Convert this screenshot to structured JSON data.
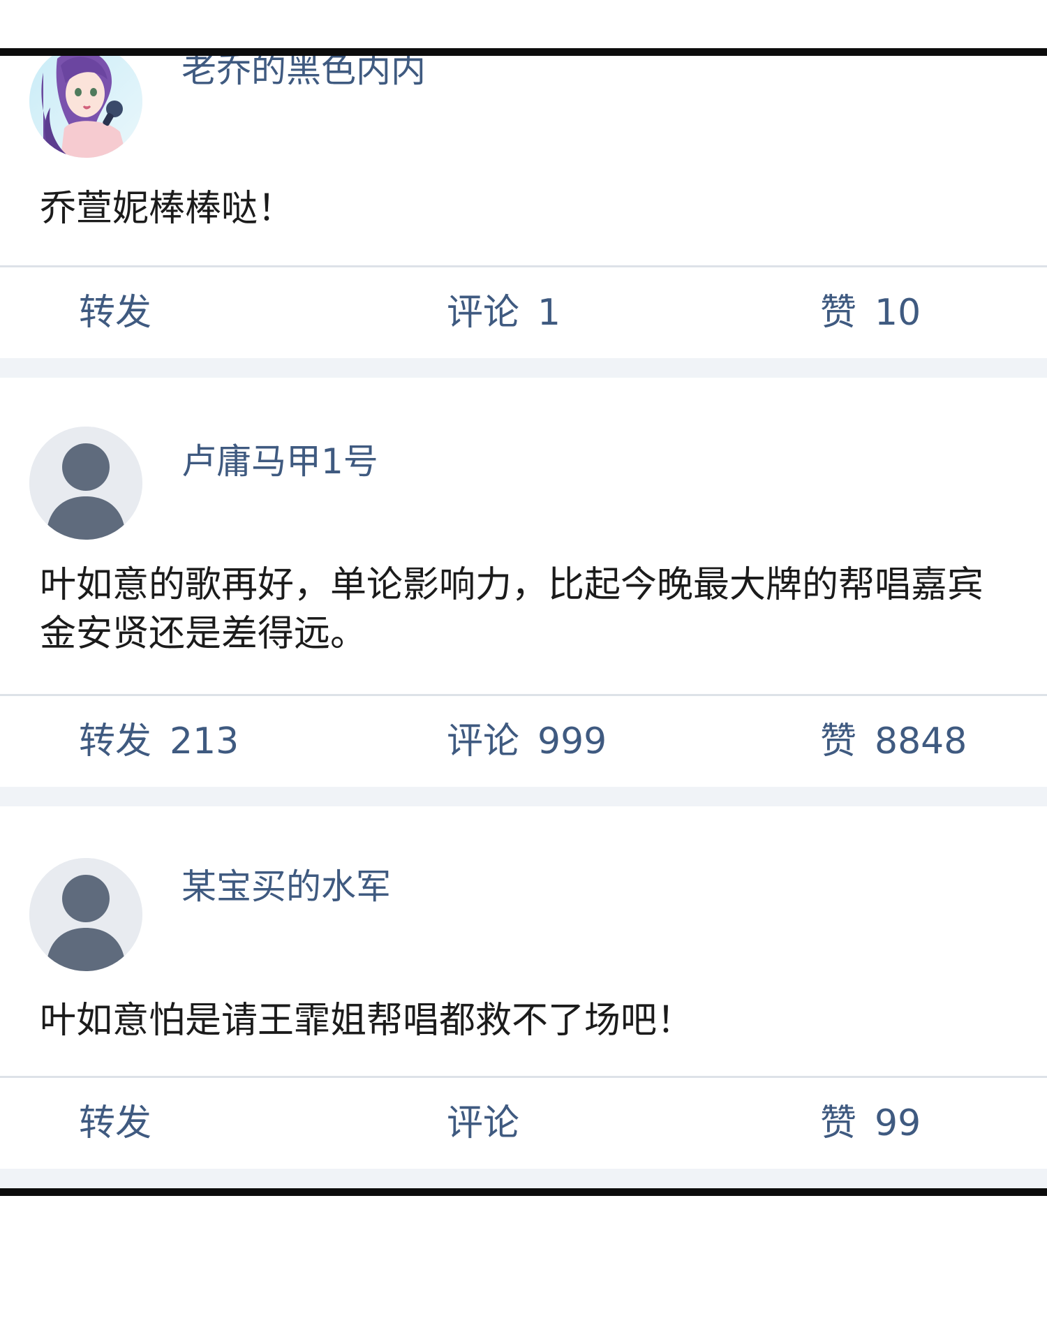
{
  "posts": [
    {
      "username": "老乔的黑色内内",
      "avatar": "anime-girl-avatar-icon",
      "content": "乔萱妮棒棒哒！",
      "repost_label": "转发",
      "repost_count": "",
      "comment_label": "评论",
      "comment_count": "1",
      "like_label": "赞",
      "like_count": "10"
    },
    {
      "username": "卢庸马甲1号",
      "avatar": "default-user-icon",
      "content": "叶如意的歌再好，单论影响力，比起今晚最大牌的帮唱嘉宾金安贤还是差得远。",
      "repost_label": "转发",
      "repost_count": "213",
      "comment_label": "评论",
      "comment_count": "999",
      "like_label": "赞",
      "like_count": "8848"
    },
    {
      "username": "某宝买的水军",
      "avatar": "default-user-icon",
      "content": "叶如意怕是请王霏姐帮唱都救不了场吧！",
      "repost_label": "转发",
      "repost_count": "",
      "comment_label": "评论",
      "comment_count": "",
      "like_label": "赞",
      "like_count": "99"
    }
  ],
  "colors": {
    "link_text": "#3f5a80",
    "body_text": "#1b1b1b",
    "divider": "#dde2e8",
    "separator": "#f0f3f7",
    "frame": "#0c0c0c",
    "default_avatar_bg": "#e8ebf0",
    "default_avatar_fg": "#5f6b7d"
  }
}
